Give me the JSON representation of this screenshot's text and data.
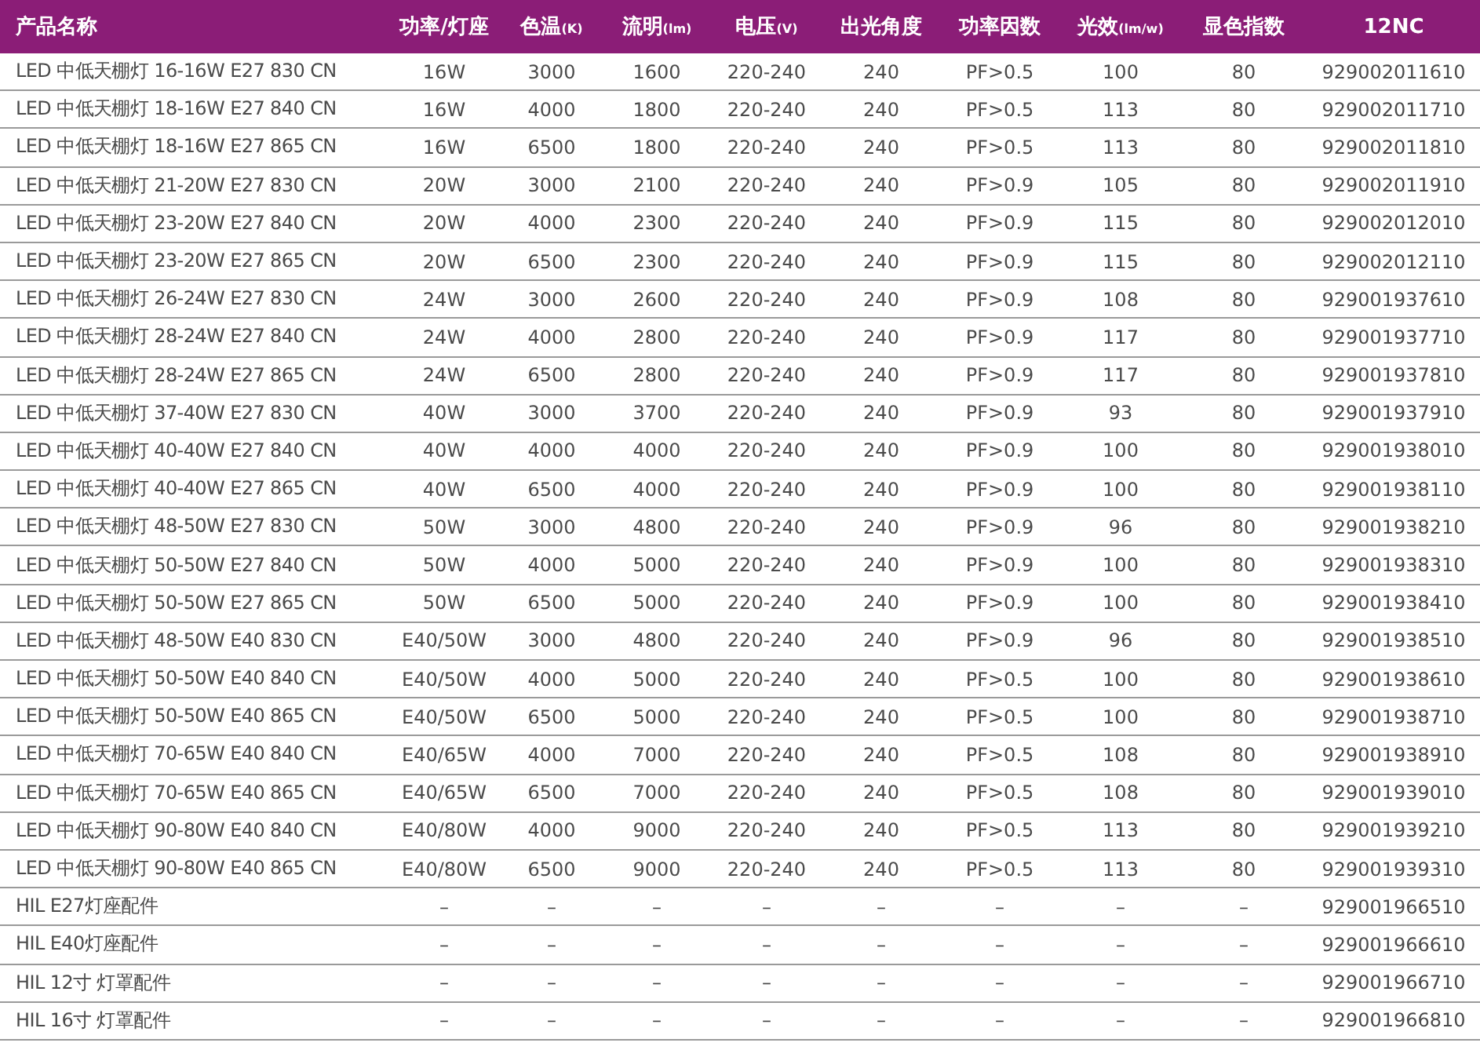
{
  "table": {
    "columns": [
      {
        "label": "产品名称"
      },
      {
        "label": "功率/灯座"
      },
      {
        "label": "色温",
        "unit": "(K)"
      },
      {
        "label": "流明",
        "unit": "(lm)"
      },
      {
        "label": "电压",
        "unit": "(V)"
      },
      {
        "label": "出光角度"
      },
      {
        "label": "功率因数"
      },
      {
        "label": "光效",
        "unit": "(lm/w)"
      },
      {
        "label": "显色指数"
      },
      {
        "label": "12NC"
      }
    ],
    "rows": [
      [
        "LED 中低天棚灯 16-16W E27 830 CN",
        "16W",
        "3000",
        "1600",
        "220-240",
        "240",
        "PF>0.5",
        "100",
        "80",
        "929002011610"
      ],
      [
        "LED 中低天棚灯 18-16W E27 840 CN",
        "16W",
        "4000",
        "1800",
        "220-240",
        "240",
        "PF>0.5",
        "113",
        "80",
        "929002011710"
      ],
      [
        "LED 中低天棚灯 18-16W E27 865 CN",
        "16W",
        "6500",
        "1800",
        "220-240",
        "240",
        "PF>0.5",
        "113",
        "80",
        "929002011810"
      ],
      [
        "LED 中低天棚灯 21-20W E27 830 CN",
        "20W",
        "3000",
        "2100",
        "220-240",
        "240",
        "PF>0.9",
        "105",
        "80",
        "929002011910"
      ],
      [
        "LED 中低天棚灯 23-20W E27 840 CN",
        "20W",
        "4000",
        "2300",
        "220-240",
        "240",
        "PF>0.9",
        "115",
        "80",
        "929002012010"
      ],
      [
        "LED 中低天棚灯 23-20W E27 865 CN",
        "20W",
        "6500",
        "2300",
        "220-240",
        "240",
        "PF>0.9",
        "115",
        "80",
        "929002012110"
      ],
      [
        "LED 中低天棚灯 26-24W E27 830 CN",
        "24W",
        "3000",
        "2600",
        "220-240",
        "240",
        "PF>0.9",
        "108",
        "80",
        "929001937610"
      ],
      [
        "LED 中低天棚灯 28-24W E27 840 CN",
        "24W",
        "4000",
        "2800",
        "220-240",
        "240",
        "PF>0.9",
        "117",
        "80",
        "929001937710"
      ],
      [
        "LED 中低天棚灯 28-24W E27 865 CN",
        "24W",
        "6500",
        "2800",
        "220-240",
        "240",
        "PF>0.9",
        "117",
        "80",
        "929001937810"
      ],
      [
        "LED 中低天棚灯 37-40W E27 830 CN",
        "40W",
        "3000",
        "3700",
        "220-240",
        "240",
        "PF>0.9",
        "93",
        "80",
        "929001937910"
      ],
      [
        "LED 中低天棚灯 40-40W E27 840 CN",
        "40W",
        "4000",
        "4000",
        "220-240",
        "240",
        "PF>0.9",
        "100",
        "80",
        "929001938010"
      ],
      [
        "LED 中低天棚灯 40-40W E27 865 CN",
        "40W",
        "6500",
        "4000",
        "220-240",
        "240",
        "PF>0.9",
        "100",
        "80",
        "929001938110"
      ],
      [
        "LED 中低天棚灯 48-50W E27 830 CN",
        "50W",
        "3000",
        "4800",
        "220-240",
        "240",
        "PF>0.9",
        "96",
        "80",
        "929001938210"
      ],
      [
        "LED 中低天棚灯 50-50W E27 840 CN",
        "50W",
        "4000",
        "5000",
        "220-240",
        "240",
        "PF>0.9",
        "100",
        "80",
        "929001938310"
      ],
      [
        "LED 中低天棚灯 50-50W E27 865 CN",
        "50W",
        "6500",
        "5000",
        "220-240",
        "240",
        "PF>0.9",
        "100",
        "80",
        "929001938410"
      ],
      [
        "LED 中低天棚灯 48-50W E40 830 CN",
        "E40/50W",
        "3000",
        "4800",
        "220-240",
        "240",
        "PF>0.9",
        "96",
        "80",
        "929001938510"
      ],
      [
        "LED 中低天棚灯 50-50W E40 840 CN",
        "E40/50W",
        "4000",
        "5000",
        "220-240",
        "240",
        "PF>0.5",
        "100",
        "80",
        "929001938610"
      ],
      [
        "LED 中低天棚灯 50-50W E40 865 CN",
        "E40/50W",
        "6500",
        "5000",
        "220-240",
        "240",
        "PF>0.5",
        "100",
        "80",
        "929001938710"
      ],
      [
        "LED 中低天棚灯 70-65W E40 840 CN",
        "E40/65W",
        "4000",
        "7000",
        "220-240",
        "240",
        "PF>0.5",
        "108",
        "80",
        "929001938910"
      ],
      [
        "LED 中低天棚灯 70-65W E40 865 CN",
        "E40/65W",
        "6500",
        "7000",
        "220-240",
        "240",
        "PF>0.5",
        "108",
        "80",
        "929001939010"
      ],
      [
        "LED 中低天棚灯 90-80W E40 840 CN",
        "E40/80W",
        "4000",
        "9000",
        "220-240",
        "240",
        "PF>0.5",
        "113",
        "80",
        "929001939210"
      ],
      [
        "LED 中低天棚灯 90-80W E40 865 CN",
        "E40/80W",
        "6500",
        "9000",
        "220-240",
        "240",
        "PF>0.5",
        "113",
        "80",
        "929001939310"
      ],
      [
        "HIL E27灯座配件",
        "–",
        "–",
        "–",
        "–",
        "–",
        "–",
        "–",
        "–",
        "929001966510"
      ],
      [
        "HIL E40灯座配件",
        "–",
        "–",
        "–",
        "–",
        "–",
        "–",
        "–",
        "–",
        "929001966610"
      ],
      [
        "HIL 12寸 灯罩配件",
        "–",
        "–",
        "–",
        "–",
        "–",
        "–",
        "–",
        "–",
        "929001966710"
      ],
      [
        "HIL 16寸 灯罩配件",
        "–",
        "–",
        "–",
        "–",
        "–",
        "–",
        "–",
        "–",
        "929001966810"
      ]
    ]
  }
}
